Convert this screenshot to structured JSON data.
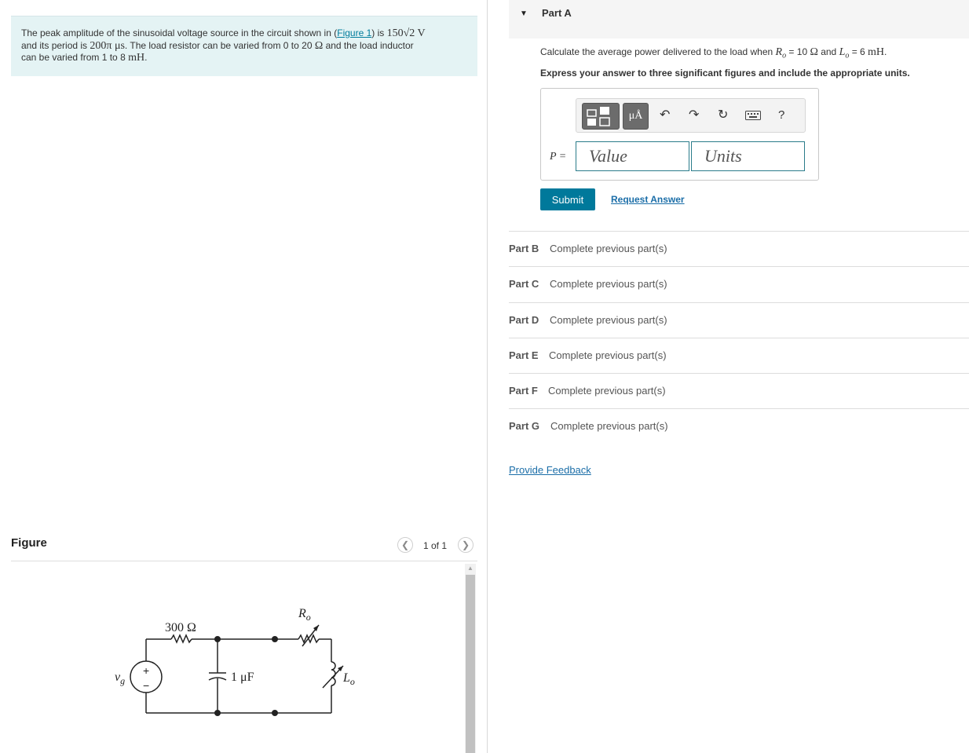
{
  "problem": {
    "text_1": "The peak amplitude of the sinusoidal voltage source in the circuit shown in (",
    "figure_link": "Figure 1",
    "text_2": ") is ",
    "amplitude": "150√2 V",
    "text_3": "and its period is ",
    "period": "200π μs",
    "text_4": ". The load resistor can be varied from 0 to 20 ",
    "ohm": "Ω",
    "text_5": " and the load inductor",
    "text_6": "can be varied from 1 to 8 ",
    "inductance_unit": "mH"
  },
  "figure": {
    "title": "Figure",
    "page_count": "1 of 1",
    "circuit": {
      "resistor_label": "300 Ω",
      "capacitor_label": "1 μF",
      "source_label": "v",
      "source_sub": "g",
      "load_resistor_label": "R",
      "load_resistor_sub": "o",
      "load_inductor_label": "L",
      "load_inductor_sub": "o",
      "plus": "+",
      "minus": "−"
    }
  },
  "part_a": {
    "title": "Part A",
    "question_1": "Calculate the average power delivered to the load when ",
    "r_symbol": "R",
    "r_sub": "o",
    "question_2": " = 10 ",
    "ohm": "Ω",
    "question_3": " and ",
    "l_symbol": "L",
    "l_sub": "o",
    "question_4": " = 6 ",
    "mh": "mH",
    "period": ".",
    "instructions": "Express your answer to three significant figures and include the appropriate units.",
    "toolbar": {
      "units_symbol": "μÅ",
      "help": "?"
    },
    "answer_label": "P =",
    "value_placeholder": "Value",
    "units_placeholder": "Units",
    "submit_label": "Submit",
    "request_label": "Request Answer"
  },
  "parts": [
    {
      "name": "Part B",
      "status": "Complete previous part(s)"
    },
    {
      "name": "Part C",
      "status": "Complete previous part(s)"
    },
    {
      "name": "Part D",
      "status": "Complete previous part(s)"
    },
    {
      "name": "Part E",
      "status": "Complete previous part(s)"
    },
    {
      "name": "Part F",
      "status": "Complete previous part(s)"
    },
    {
      "name": "Part G",
      "status": "Complete previous part(s)"
    }
  ],
  "feedback_label": "Provide Feedback"
}
